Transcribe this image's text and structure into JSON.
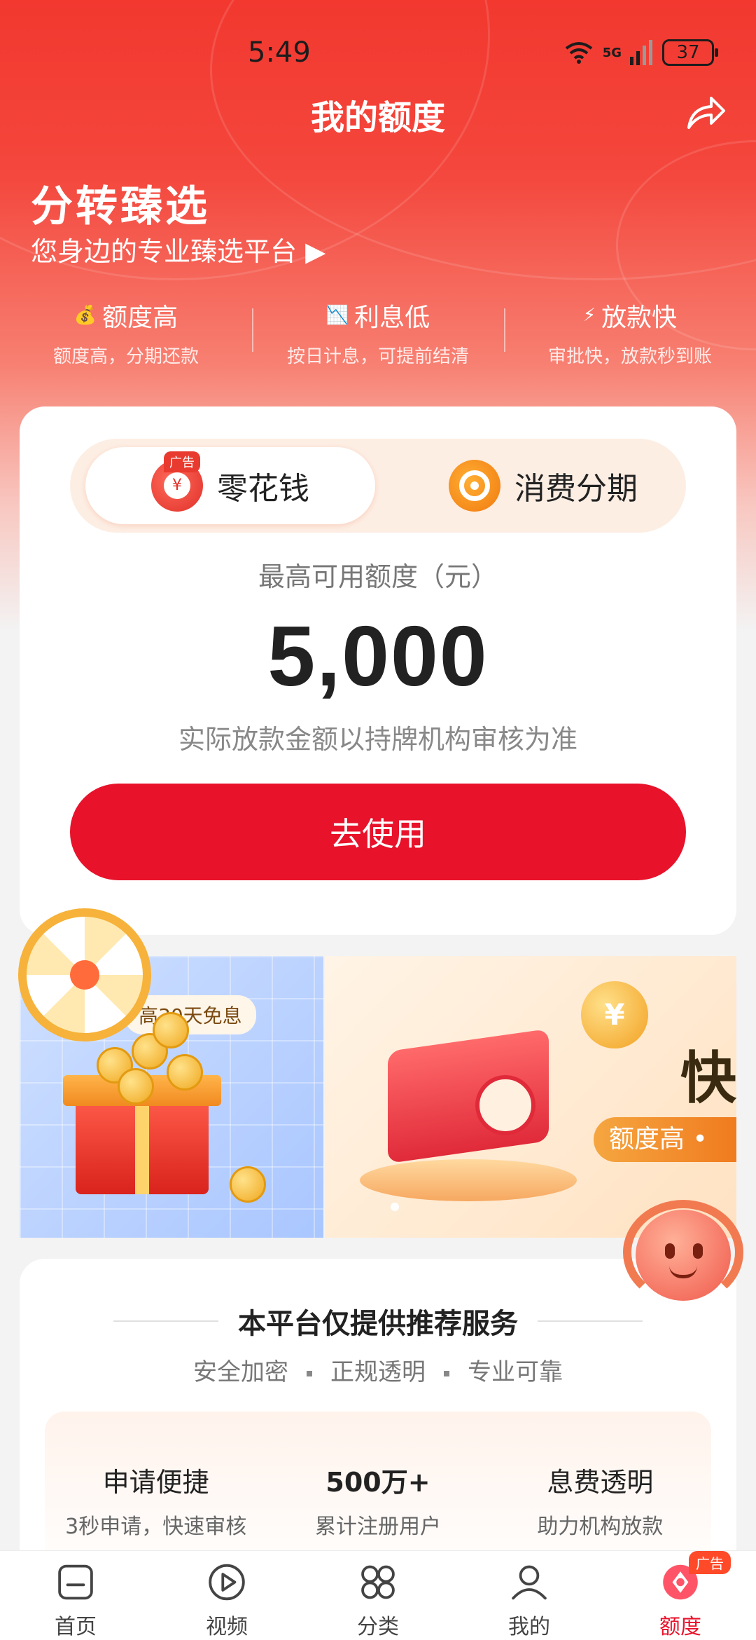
{
  "status_bar": {
    "time": "5:49",
    "wifi_label": "6",
    "network": "5G",
    "battery": "37"
  },
  "header": {
    "title": "我的额度",
    "share_icon": "share-icon"
  },
  "brand": {
    "title": "分转臻选",
    "subtitle": "您身边的专业臻选平台 ▶"
  },
  "features": [
    {
      "icon": "money-bag-icon",
      "glyph": "💰",
      "title": "额度高",
      "desc": "额度高，分期还款"
    },
    {
      "icon": "chart-icon",
      "glyph": "📉",
      "title": "利息低",
      "desc": "按日计息，可提前结清"
    },
    {
      "icon": "lightning-icon",
      "glyph": "⚡",
      "title": "放款快",
      "desc": "审批快，放款秒到账"
    }
  ],
  "product_tabs": {
    "active": {
      "label": "零花钱",
      "badge": "广告",
      "icon": "yen-coin-icon"
    },
    "inactive": {
      "label": "消费分期",
      "icon": "target-coin-icon"
    }
  },
  "credit": {
    "label": "最高可用额度（元）",
    "value": "5,000",
    "note": "实际放款金额以持牌机构审核为准",
    "button": "去使用"
  },
  "banner": {
    "left_pill": "高30天免息",
    "right_big_text": "快",
    "right_pill": "额度高 •",
    "right_coin": "¥",
    "slide_count": 2,
    "active_slide": 1
  },
  "info": {
    "title": "本平台仅提供推荐服务",
    "tags": [
      "安全加密",
      "正规透明",
      "专业可靠"
    ],
    "stats": [
      {
        "title": "申请便捷",
        "desc": "3秒申请，快速审核"
      },
      {
        "title": "500万+",
        "desc": "累计注册用户"
      },
      {
        "title": "息费透明",
        "desc": "助力机构放款"
      }
    ]
  },
  "tabbar": {
    "items": [
      {
        "label": "首页",
        "icon": "home-icon"
      },
      {
        "label": "视频",
        "icon": "play-icon"
      },
      {
        "label": "分类",
        "icon": "category-icon"
      },
      {
        "label": "我的",
        "icon": "profile-icon"
      },
      {
        "label": "额度",
        "icon": "credit-icon",
        "badge": "广告"
      }
    ],
    "active_index": 4
  },
  "colors": {
    "brand_red": "#e8122b",
    "header_red": "#f2382f",
    "accent_orange": "#f07a1e"
  }
}
